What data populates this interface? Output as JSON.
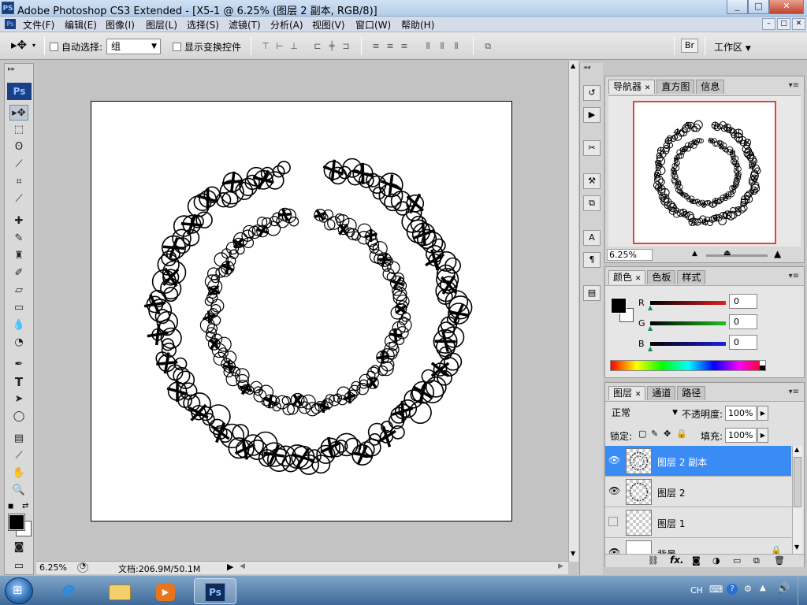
{
  "window": {
    "app_icon": "PS",
    "title": "Adobe Photoshop CS3 Extended - [X5-1 @ 6.25% (图层 2 副本, RGB/8)]",
    "buttons": {
      "minimize": "_",
      "maximize": "□",
      "close": "✕"
    }
  },
  "menu": {
    "items": [
      "文件(F)",
      "编辑(E)",
      "图像(I)",
      "图层(L)",
      "选择(S)",
      "滤镜(T)",
      "分析(A)",
      "视图(V)",
      "窗口(W)",
      "帮助(H)"
    ],
    "doc_buttons": [
      "–",
      "□",
      "✕"
    ]
  },
  "options": {
    "auto_select_label": "自动选择:",
    "auto_select_value": "组",
    "show_transform_label": "显示变换控件",
    "workspace_label": "工作区"
  },
  "toolbox": {
    "ps_label": "Ps"
  },
  "status": {
    "zoom": "6.25%",
    "doc_info": "文档:206.9M/50.1M"
  },
  "navigator": {
    "tabs": [
      "导航器",
      "直方图",
      "信息"
    ],
    "zoom": "6.25%"
  },
  "color": {
    "tabs": [
      "颜色",
      "色板",
      "样式"
    ],
    "channels": [
      {
        "label": "R",
        "value": "0",
        "color": "#e02020"
      },
      {
        "label": "G",
        "value": "0",
        "color": "#20c020"
      },
      {
        "label": "B",
        "value": "0",
        "color": "#2020e0"
      }
    ]
  },
  "layers": {
    "tabs": [
      "图层",
      "通道",
      "路径"
    ],
    "blend_mode": "正常",
    "opacity_label": "不透明度:",
    "opacity": "100%",
    "lock_label": "锁定:",
    "fill_label": "填充:",
    "fill": "100%",
    "items": [
      {
        "name": "图层 2 副本",
        "visible": true,
        "selected": true
      },
      {
        "name": "图层 2",
        "visible": true,
        "selected": false
      },
      {
        "name": "图层 1",
        "visible": false,
        "selected": false
      },
      {
        "name": "背景",
        "visible": true,
        "selected": false
      }
    ]
  },
  "taskbar": {
    "tray_lang": "CH"
  }
}
